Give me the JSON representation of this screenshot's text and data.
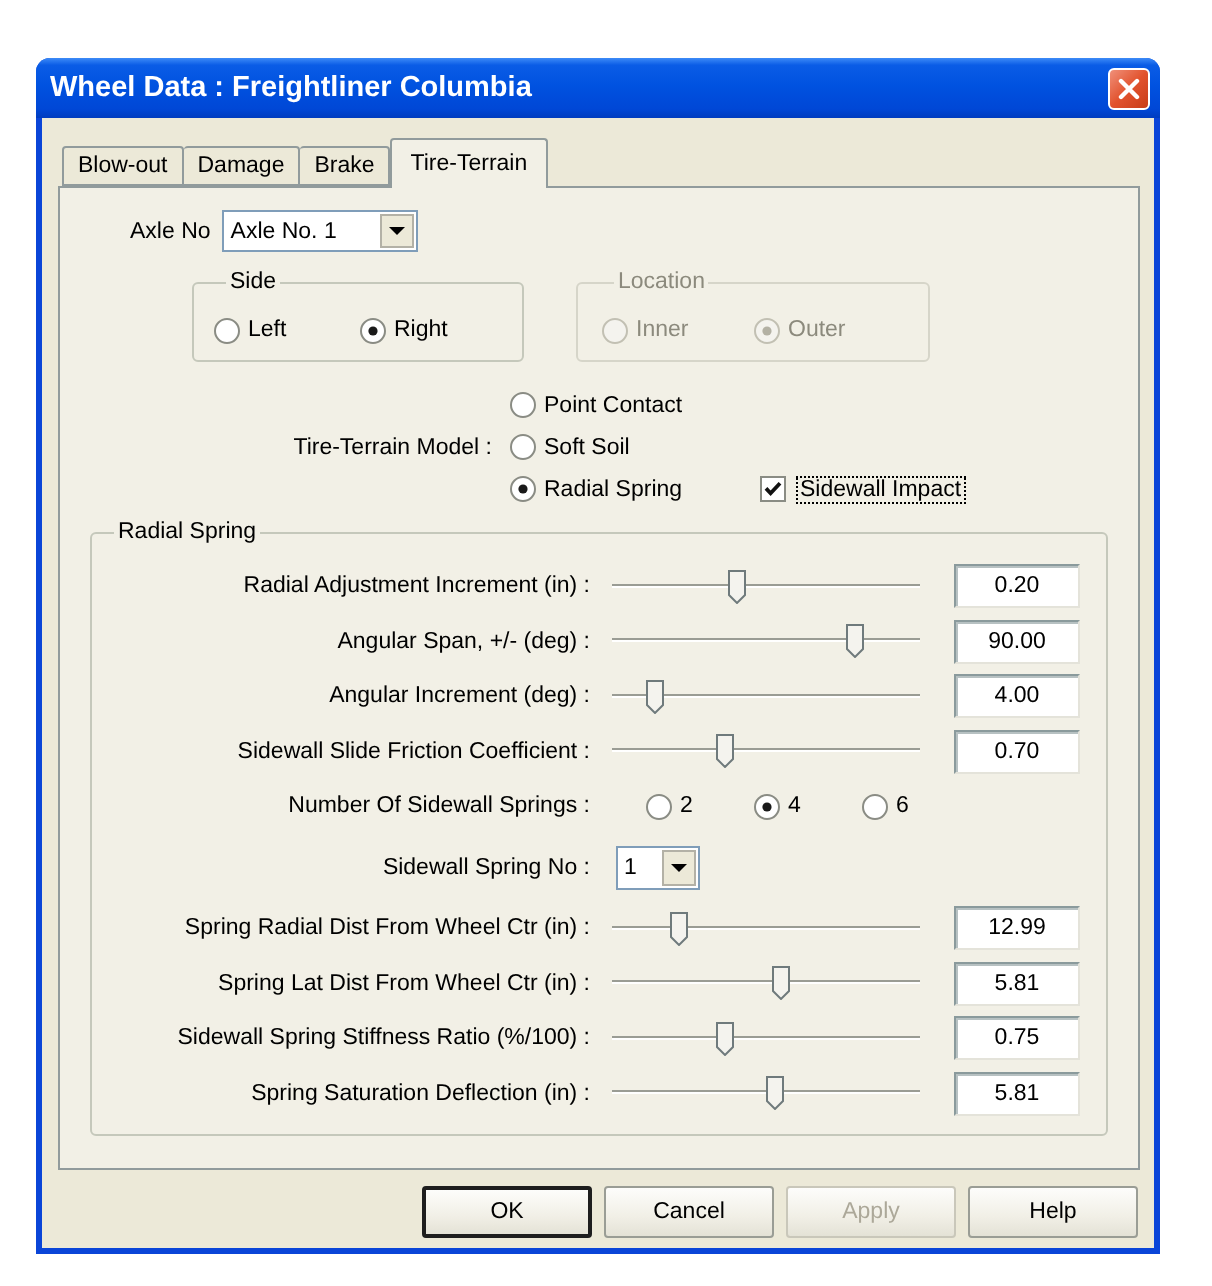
{
  "window": {
    "title": "Wheel Data : Freightliner Columbia"
  },
  "tabs": [
    {
      "label": "Blow-out",
      "selected": false
    },
    {
      "label": "Damage",
      "selected": false
    },
    {
      "label": "Brake",
      "selected": false
    },
    {
      "label": "Tire-Terrain",
      "selected": true
    }
  ],
  "axle": {
    "label": "Axle No",
    "value": "Axle No. 1"
  },
  "side": {
    "title": "Side",
    "disabled": false,
    "options": [
      {
        "label": "Left",
        "selected": false
      },
      {
        "label": "Right",
        "selected": true
      }
    ]
  },
  "location": {
    "title": "Location",
    "disabled": true,
    "options": [
      {
        "label": "Inner",
        "selected": false
      },
      {
        "label": "Outer",
        "selected": true
      }
    ]
  },
  "tire_terrain_model": {
    "label": "Tire-Terrain Model :",
    "options": [
      {
        "label": "Point Contact",
        "selected": false
      },
      {
        "label": "Soft Soil",
        "selected": false
      },
      {
        "label": "Radial Spring",
        "selected": true
      }
    ],
    "sidewall_impact": {
      "label": "Sidewall Impact",
      "checked": true,
      "focused": true
    }
  },
  "radial_spring": {
    "title": "Radial Spring",
    "rows": [
      {
        "kind": "slider",
        "label": "Radial Adjustment Increment (in) :",
        "level": 0.4,
        "value": "0.20"
      },
      {
        "kind": "slider",
        "label": "Angular Span, +/- (deg) :",
        "level": 0.81,
        "value": "90.00"
      },
      {
        "kind": "slider",
        "label": "Angular Increment (deg) :",
        "level": 0.12,
        "value": "4.00"
      },
      {
        "kind": "slider",
        "label": "Sidewall Slide Friction Coefficient :",
        "level": 0.36,
        "value": "0.70"
      },
      {
        "kind": "radio",
        "label": "Number Of Sidewall Springs :",
        "options": [
          {
            "label": "2",
            "selected": false
          },
          {
            "label": "4",
            "selected": true
          },
          {
            "label": "6",
            "selected": false
          }
        ]
      },
      {
        "kind": "dropdown",
        "label": "Sidewall Spring No :",
        "value": "1"
      },
      {
        "kind": "slider",
        "label": "Spring Radial Dist From Wheel Ctr (in) :",
        "level": 0.2,
        "value": "12.99"
      },
      {
        "kind": "slider",
        "label": "Spring Lat Dist From Wheel Ctr (in) :",
        "level": 0.55,
        "value": "5.81"
      },
      {
        "kind": "slider",
        "label": "Sidewall Spring Stiffness Ratio (%/100) :",
        "level": 0.36,
        "value": "0.75"
      },
      {
        "kind": "slider",
        "label": "Spring Saturation Deflection (in) :",
        "level": 0.53,
        "value": "5.81"
      }
    ]
  },
  "buttons": [
    {
      "label": "OK",
      "default": true,
      "disabled": false
    },
    {
      "label": "Cancel",
      "default": false,
      "disabled": false
    },
    {
      "label": "Apply",
      "default": false,
      "disabled": true
    },
    {
      "label": "Help",
      "default": false,
      "disabled": false
    }
  ]
}
